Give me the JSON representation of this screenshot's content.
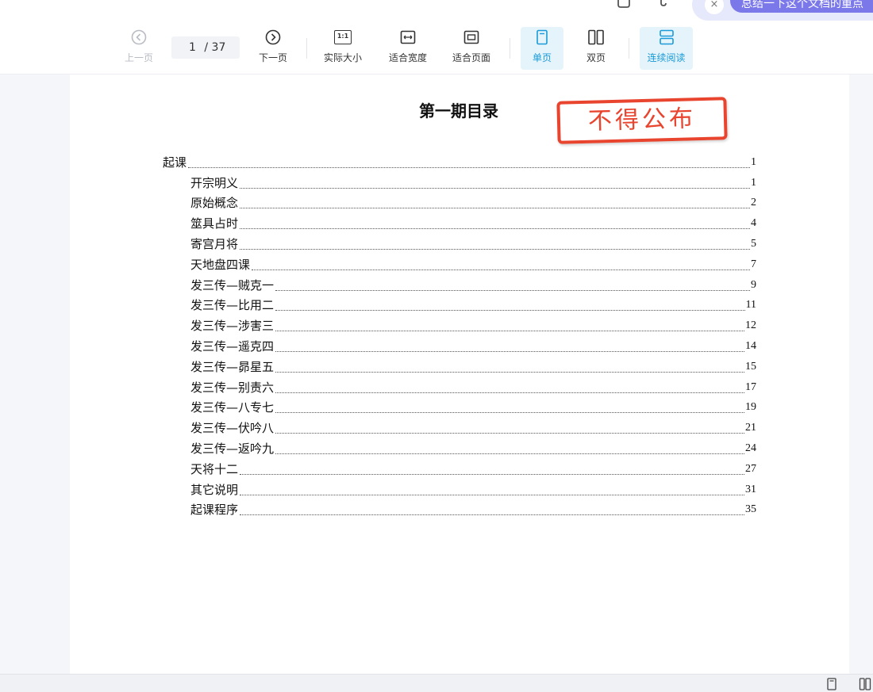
{
  "ai_assistant": {
    "close": "×",
    "text": "总结一下这个文档的重点"
  },
  "toolbar": {
    "prev_label": "上一页",
    "page_current": "1",
    "page_total": "/ 37",
    "next_label": "下一页",
    "actual_size_label": "实际大小",
    "actual_size_icon_text": "1:1",
    "fit_width_label": "适合宽度",
    "fit_page_label": "适合页面",
    "single_page_label": "单页",
    "double_page_label": "双页",
    "continuous_label": "连续阅读"
  },
  "document": {
    "title": "第一期目录",
    "stamp": "不得公布",
    "toc": [
      {
        "text": "起课",
        "page": "1",
        "level": 0
      },
      {
        "text": "开宗明义",
        "page": "1",
        "level": 1
      },
      {
        "text": "原始概念",
        "page": "2",
        "level": 1
      },
      {
        "text": "筮具占时",
        "page": "4",
        "level": 1
      },
      {
        "text": "寄宫月将",
        "page": "5",
        "level": 1
      },
      {
        "text": "天地盘四课",
        "page": "7",
        "level": 1
      },
      {
        "text": "发三传—贼克一",
        "page": "9",
        "level": 1
      },
      {
        "text": "发三传—比用二",
        "page": "11",
        "level": 1
      },
      {
        "text": "发三传—涉害三",
        "page": "12",
        "level": 1
      },
      {
        "text": "发三传—遥克四",
        "page": "14",
        "level": 1
      },
      {
        "text": "发三传—昴星五",
        "page": "15",
        "level": 1
      },
      {
        "text": "发三传—别责六",
        "page": "17",
        "level": 1
      },
      {
        "text": "发三传—八专七",
        "page": "19",
        "level": 1
      },
      {
        "text": "发三传—伏吟八",
        "page": "21",
        "level": 1
      },
      {
        "text": "发三传—返吟九",
        "page": "24",
        "level": 1
      },
      {
        "text": "天将十二",
        "page": "27",
        "level": 1
      },
      {
        "text": "其它说明",
        "page": "31",
        "level": 1
      },
      {
        "text": "起课程序",
        "page": "35",
        "level": 1
      }
    ]
  },
  "colors": {
    "accent": "#1a9bd7",
    "active_bg": "#e5f3fb",
    "stamp_red": "#e8442e",
    "ai_purple": "#7b78ea"
  }
}
